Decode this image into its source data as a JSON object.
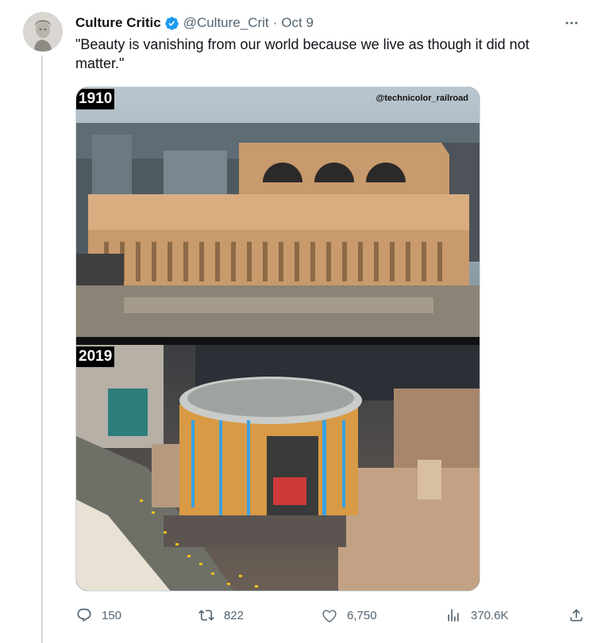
{
  "tweet": {
    "author": {
      "display_name": "Culture Critic",
      "handle": "@Culture_Crit",
      "separator": "·",
      "verified": true
    },
    "date": "Oct 9",
    "text": "\"Beauty is vanishing from our world because we live as though it did not matter.\"",
    "media": {
      "top_label": "1910",
      "bottom_label": "2019",
      "watermark": "@technicolor_railroad"
    },
    "actions": {
      "replies": "150",
      "reposts": "822",
      "likes": "6,750",
      "views": "370.6K"
    }
  },
  "colors": {
    "text_primary": "#0f1419",
    "text_secondary": "#536471",
    "verified_blue": "#1d9bf0",
    "divider": "#cfd9de"
  },
  "icons": [
    "verified-badge-icon",
    "more-options-icon",
    "reply-icon",
    "repost-icon",
    "like-icon",
    "views-icon",
    "share-icon"
  ]
}
